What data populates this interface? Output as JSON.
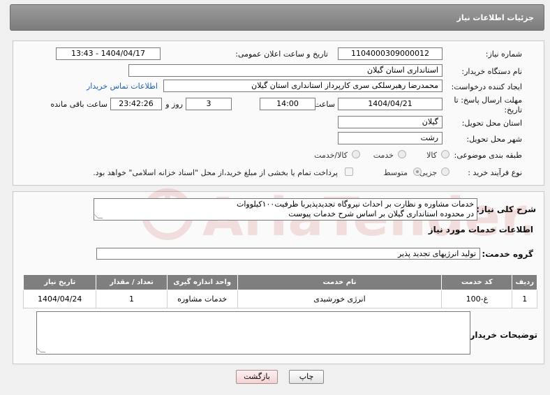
{
  "header": {
    "title": "جزئیات اطلاعات نیاز"
  },
  "info": {
    "need_number_label": "شماره نیاز:",
    "need_number": "1104000309000012",
    "announce_label": "تاریخ و ساعت اعلان عمومی:",
    "announce_value": "1404/04/17 - 13:43",
    "buyer_org_label": "نام دستگاه خریدار:",
    "buyer_org": "استانداری استان گیلان",
    "creator_label": "ایجاد کننده درخواست:",
    "creator": "محمدرضا رهبرسلکی سری کارپرداز استانداری استان گیلان",
    "contact_link": "اطلاعات تماس خریدار",
    "deadline_label": "مهلت ارسال پاسخ: تا تاریخ:",
    "deadline_date": "1404/04/21",
    "time_label": "ساعت",
    "deadline_time": "14:00",
    "days_value": "3",
    "days_label": "روز و",
    "remaining_time": "23:42:26",
    "remaining_label": "ساعت باقی مانده",
    "province_label": "استان محل تحویل:",
    "province": "گیلان",
    "city_label": "شهر محل تحویل:",
    "city": "رشت",
    "category_label": "طبقه بندی موضوعی:",
    "category_options": [
      "کالا",
      "خدمت",
      "کالا/خدمت"
    ],
    "process_label": "نوع فرآیند خرید :",
    "process_options": [
      "جزیی",
      "متوسط"
    ],
    "payment_note": "پرداخت تمام یا بخشی از مبلغ خرید،از محل \"اسناد خزانه اسلامی\" خواهد بود."
  },
  "need": {
    "summary_label": "شرح کلی نیاز:",
    "summary_line1": "خدمات مشاوره و نظارت بر احداث نیروگاه تجدیدپذیربا ظرفیت۱۰۰کیلووات",
    "summary_line2": "در محدوده استانداری گیلان بر اساس شرح خدمات پیوست",
    "services_title": "اطلاعات خدمات مورد نیاز",
    "group_label": "گروه خدمت:",
    "group_value": "تولید انرژیهای تجدید پذیر"
  },
  "table": {
    "headers": [
      "ردیف",
      "کد خدمت",
      "نام خدمت",
      "واحد اندازه گیری",
      "تعداد / مقدار",
      "تاریخ نیاز"
    ],
    "rows": [
      [
        "1",
        "غ-100",
        "انرژی خورشیدی",
        "خدمات مشاوره",
        "1",
        "1404/04/24"
      ]
    ]
  },
  "buyer_notes_label": "توضیحات خریدار:",
  "buttons": {
    "print": "چاپ",
    "back": "بازگشت"
  },
  "watermark_text": "AriaTender.neT"
}
